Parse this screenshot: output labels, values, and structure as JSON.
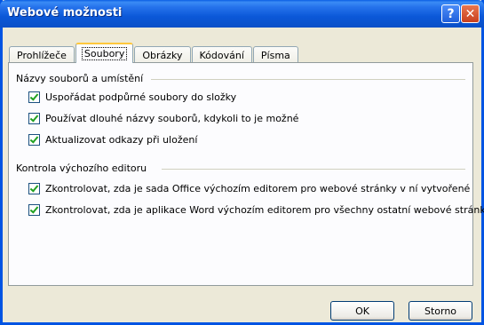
{
  "window": {
    "title": "Webové možnosti"
  },
  "titlebar_buttons": {
    "help": "?",
    "close": "✕"
  },
  "tabs": [
    {
      "label": "Prohlížeče",
      "active": false
    },
    {
      "label": "Soubory",
      "active": true
    },
    {
      "label": "Obrázky",
      "active": false
    },
    {
      "label": "Kódování",
      "active": false
    },
    {
      "label": "Písma",
      "active": false
    }
  ],
  "groups": {
    "files": {
      "label": "Názvy souborů a umístění",
      "options": [
        {
          "label": "Uspořádat podpůrné soubory do složky",
          "checked": true
        },
        {
          "label": "Používat dlouhé názvy souborů, kdykoli to je možné",
          "checked": true
        },
        {
          "label": "Aktualizovat odkazy při uložení",
          "checked": true
        }
      ]
    },
    "editor": {
      "label": "Kontrola výchozího editoru",
      "options": [
        {
          "label": "Zkontrolovat, zda je sada Office výchozím editorem pro webové stránky v ní vytvořené",
          "checked": true
        },
        {
          "label": "Zkontrolovat, zda je aplikace Word výchozím editorem pro všechny ostatní webové stránky",
          "checked": true
        }
      ]
    }
  },
  "buttons": {
    "ok": "OK",
    "cancel": "Storno"
  },
  "colors": {
    "titlebar": "#0a5fe4",
    "dialog_bg": "#ece9d8",
    "tab_highlight": "#ffc83c",
    "check": "#21a121"
  }
}
